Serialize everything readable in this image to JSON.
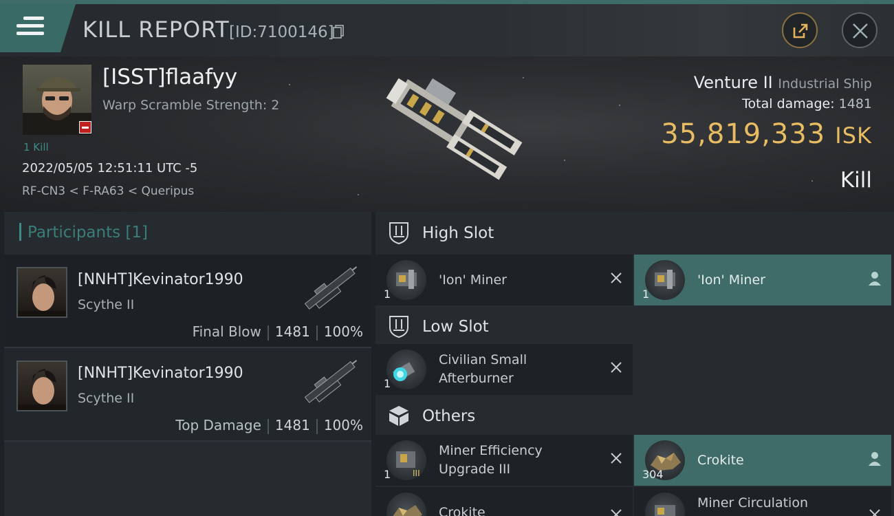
{
  "header": {
    "title": "KILL REPORT",
    "report_id": "[ID:7100146]"
  },
  "victim": {
    "name": "[ISST]flaafyy",
    "warp_scramble": "Warp Scramble Strength: 2",
    "kills": "1 Kill",
    "datetime": "2022/05/05 12:51:11 UTC -5",
    "location": "RF-CN3 < F-RA63 < Queripus",
    "ship_name": "Venture II",
    "ship_class": "Industrial Ship",
    "total_damage_label": "Total damage:",
    "total_damage": "1481",
    "isk_value": "35,819,333",
    "isk_unit": "ISK",
    "result": "Kill"
  },
  "participants": {
    "label": "Participants",
    "count": "[1]",
    "rows": [
      {
        "name": "[NNHT]Kevinator1990",
        "ship": "Scythe II",
        "role": "Final Blow",
        "damage": "1481",
        "percent": "100%"
      },
      {
        "name": "[NNHT]Kevinator1990",
        "ship": "Scythe II",
        "role": "Top Damage",
        "damage": "1481",
        "percent": "100%"
      }
    ]
  },
  "fittings": {
    "high_slot": {
      "label": "High Slot",
      "items": [
        {
          "name": "'Ion' Miner",
          "qty": "1"
        },
        {
          "name": "'Ion' Miner",
          "qty": "1"
        }
      ]
    },
    "low_slot": {
      "label": "Low Slot",
      "items": [
        {
          "name_line1": "Civilian Small",
          "name_line2": "Afterburner",
          "qty": "1"
        }
      ]
    },
    "others": {
      "label": "Others",
      "items": [
        {
          "name_line1": "Miner Efficiency",
          "name_line2": "Upgrade III",
          "qty": "1"
        },
        {
          "name": "Crokite",
          "qty": "304"
        },
        {
          "name": "Crokite",
          "qty": ""
        },
        {
          "name": "Miner Circulation",
          "qty": ""
        }
      ]
    }
  },
  "colors": {
    "accent_teal": "#3f6b68",
    "isk_gold": "#e8bc62",
    "minus_badge": "#c02020"
  },
  "icons": {
    "menu": "hamburger-icon",
    "copy": "copy-icon",
    "share": "share-icon",
    "close": "close-icon",
    "dropped": "person-icon",
    "destroyed": "x-icon"
  }
}
